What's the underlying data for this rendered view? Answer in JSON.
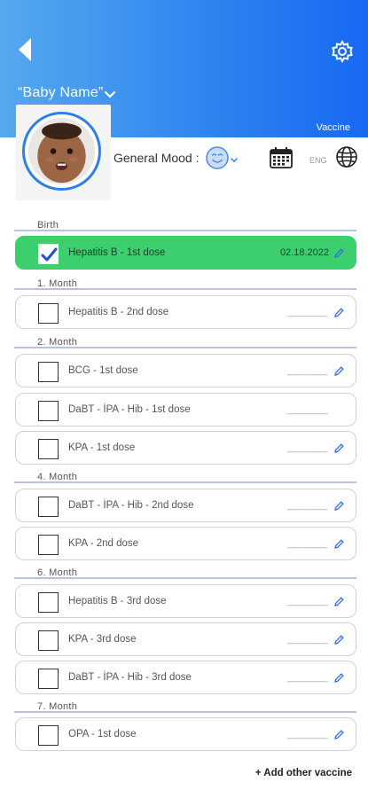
{
  "header": {
    "baby_name": "“Baby Name”",
    "section_title": "Vaccine"
  },
  "mood": {
    "label": "General Mood :",
    "current": "smiling-face-icon"
  },
  "language": {
    "code": "ENG"
  },
  "icons": {
    "back": "back-arrow-icon",
    "settings": "gear-icon",
    "calendar": "calendar-icon",
    "language": "globe-icon",
    "edit": "pencil-icon"
  },
  "colors": {
    "header_start": "#56a8ee",
    "header_end": "#1769f2",
    "completed": "#3ccf6e",
    "accent": "#2f7fe8"
  },
  "groups": [
    {
      "title": "Birth",
      "items": [
        {
          "name": "Hepatitis B - 1st dose",
          "date": "02.18.2022",
          "checked": true
        }
      ]
    },
    {
      "title": "1. Month",
      "items": [
        {
          "name": "Hepatitis B - 2nd dose",
          "date": "________",
          "checked": false
        }
      ]
    },
    {
      "title": "2. Month",
      "items": [
        {
          "name": "BCG - 1st dose",
          "date": "________",
          "checked": false
        },
        {
          "name": "DaBT - İPA - Hib - 1st dose",
          "date": "________",
          "checked": false
        },
        {
          "name": "KPA - 1st dose",
          "date": "________",
          "checked": false
        }
      ]
    },
    {
      "title": "4. Month",
      "items": [
        {
          "name": "DaBT - İPA - Hib - 2nd dose",
          "date": "________",
          "checked": false
        },
        {
          "name": "KPA - 2nd dose",
          "date": "________",
          "checked": false
        }
      ]
    },
    {
      "title": "6. Month",
      "items": [
        {
          "name": "Hepatitis B - 3rd dose",
          "date": "________",
          "checked": false
        },
        {
          "name": "KPA - 3rd dose",
          "date": "________",
          "checked": false
        },
        {
          "name": "DaBT - İPA - Hib - 3rd dose",
          "date": "________",
          "checked": false
        }
      ]
    },
    {
      "title": "7. Month",
      "items": [
        {
          "name": "OPA - 1st dose",
          "date": "________",
          "checked": false
        }
      ]
    }
  ],
  "add_button": "+ Add other vaccine"
}
